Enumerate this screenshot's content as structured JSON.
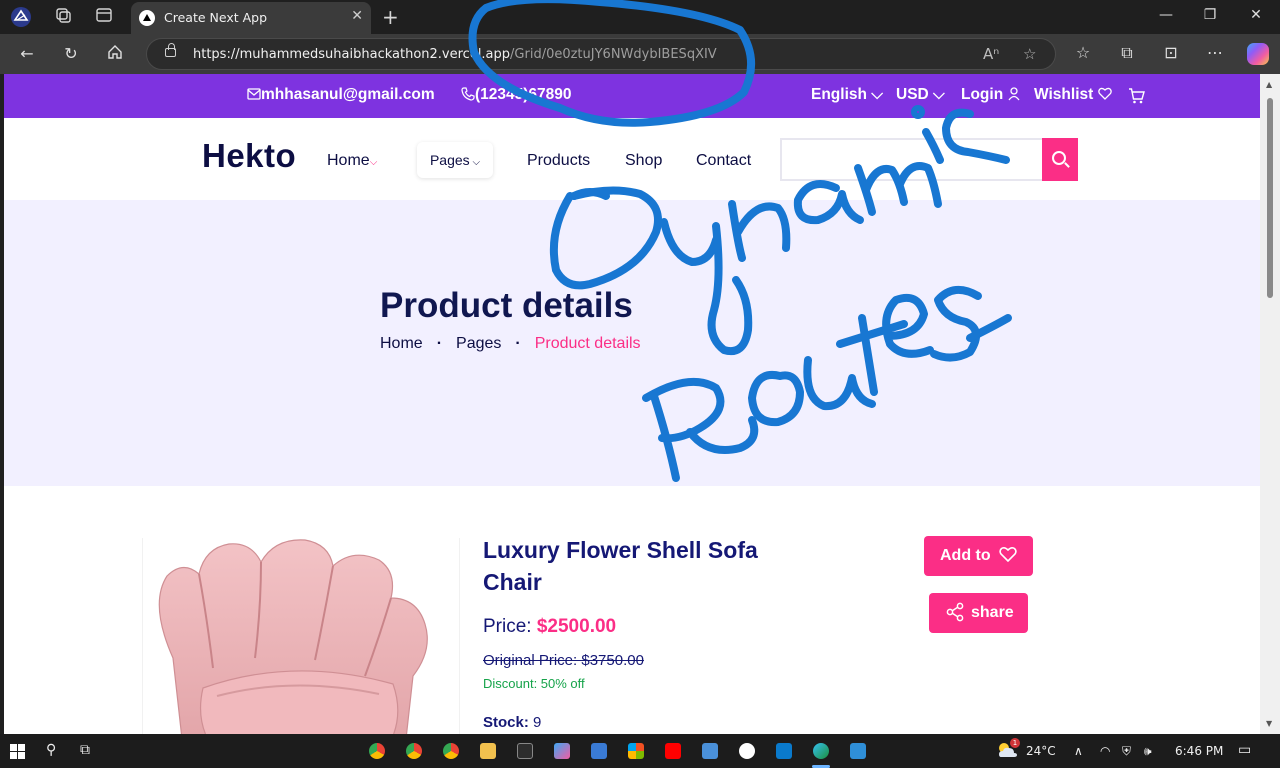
{
  "browser": {
    "tab_title": "Create Next App",
    "url_host": "https://muhammedsuhaibhackathon2.vercel.app",
    "url_path": "/Grid/0e0ztuJY6NWdybIBESqXIV"
  },
  "site": {
    "topbar": {
      "email": "mhhasanul@gmail.com",
      "phone": "(12345)67890",
      "language": "English",
      "currency": "USD",
      "login": "Login",
      "wishlist": "Wishlist"
    },
    "logo": "Hekto",
    "nav": {
      "home": "Home",
      "pages": "Pages",
      "products": "Products",
      "shop": "Shop",
      "contact": "Contact"
    },
    "search": {
      "placeholder": ""
    },
    "hero": {
      "title": "Product details",
      "breadcrumb": [
        "Home",
        "Pages",
        "Product details"
      ]
    },
    "product": {
      "name": "Luxury Flower Shell Sofa Chair",
      "price_label": "Price:",
      "price": "$2500.00",
      "original_price": "Original Price: $3750.00",
      "discount": "Discount: 50% off",
      "stock_label": "Stock:",
      "stock": "9",
      "add_to_label": "Add to",
      "share_label": "share"
    }
  },
  "annotation": {
    "text": "Dynamic Routes",
    "color": "#1877d2"
  },
  "taskbar": {
    "temperature": "24°C",
    "time": "6:46 PM",
    "weather_badge": "1"
  },
  "colors": {
    "topbar": "#7e33e0",
    "accent": "#fb2e86",
    "navy": "#0d0e43",
    "hero_bg": "#f2f0ff",
    "discount": "#16a34a"
  }
}
